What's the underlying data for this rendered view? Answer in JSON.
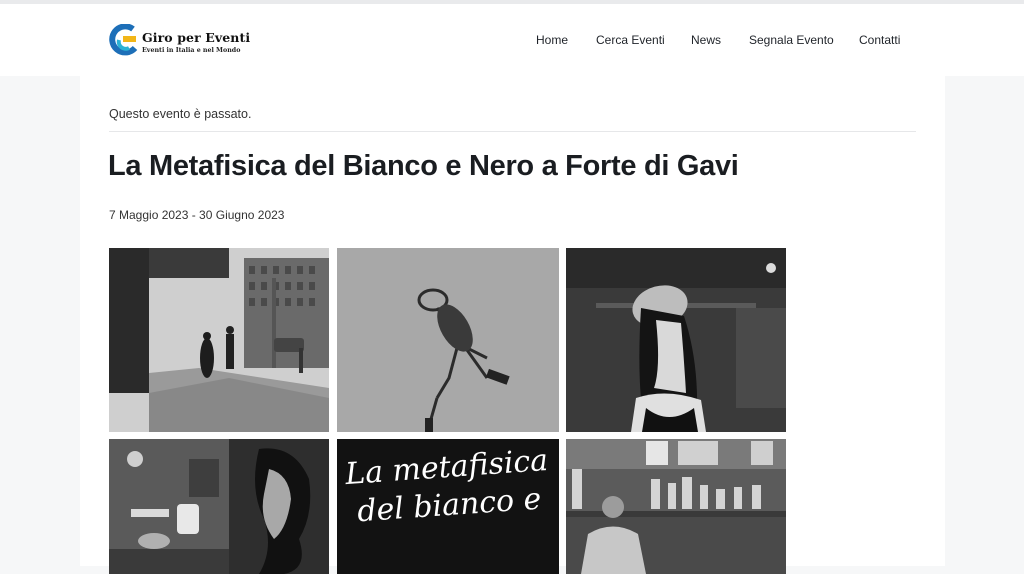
{
  "site": {
    "logo_title": "Giro per Eventi",
    "logo_subtitle": "Eventi in Italia e nel Mondo"
  },
  "nav": {
    "items": [
      {
        "label": "Home"
      },
      {
        "label": "Cerca Eventi"
      },
      {
        "label": "News"
      },
      {
        "label": "Segnala Evento"
      },
      {
        "label": "Contatti"
      }
    ]
  },
  "event": {
    "notice": "Questo evento è passato.",
    "title": "La Metafisica del Bianco e Nero a Forte di Gavi",
    "dates": "7 Maggio 2023 - 30 Giugno 2023"
  },
  "gallery": {
    "poster_text": "La metafisica del bianco e"
  },
  "colors": {
    "logo_blue": "#1d6fb8",
    "logo_yellow": "#f2b618",
    "logo_cyan": "#2bb3d6"
  }
}
